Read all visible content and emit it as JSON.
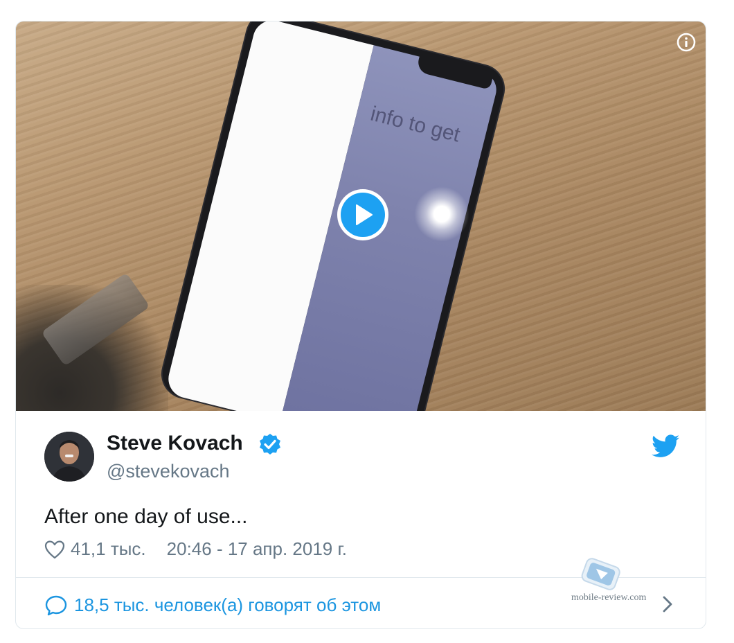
{
  "video": {
    "screen_text": "info to get"
  },
  "tweet": {
    "author_name": "Steve Kovach",
    "handle": "@stevekovach",
    "text": "After one day of use...",
    "likes": "41,1 тыс.",
    "timestamp": "20:46 - 17 апр. 2019 г."
  },
  "footer": {
    "conversation_text": "18,5 тыс. человек(а) говорят об этом"
  },
  "watermark": {
    "text": "mobile-review.com"
  },
  "colors": {
    "twitter_blue": "#1da1f2",
    "link_blue": "#1b95e0",
    "text_primary": "#14171a",
    "text_secondary": "#657786",
    "border": "#e1e8ed"
  },
  "icons": [
    "info-icon",
    "play-icon",
    "verified-badge-icon",
    "twitter-bird-icon",
    "heart-icon",
    "chat-bubble-icon",
    "chevron-right-icon"
  ]
}
